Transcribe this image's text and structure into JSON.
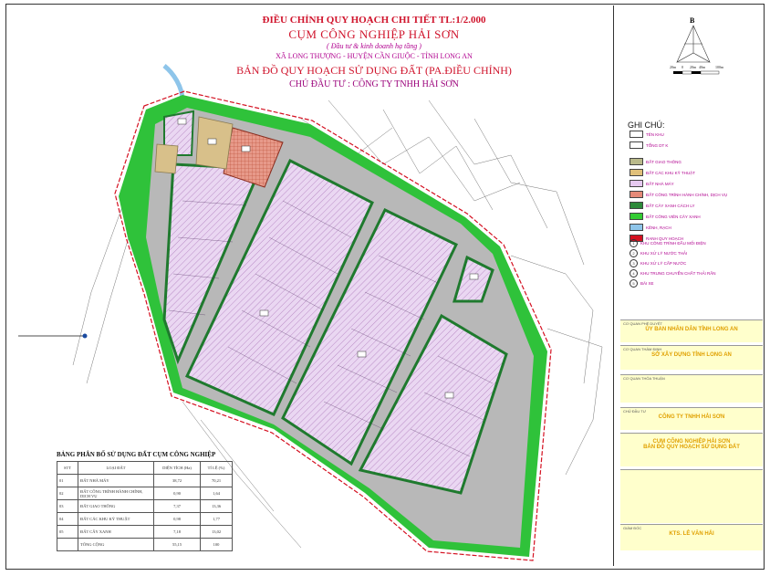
{
  "header": {
    "line1": "ĐIỀU CHỈNH QUY HOẠCH CHI TIẾT TL:1/2.000",
    "line2": "CỤM CÔNG NGHIỆP HẢI SƠN",
    "line3": "( Đầu tư & kinh doanh hạ tầng )",
    "line4": "XÃ LONG THƯỢNG - HUYỆN CẦN GIUỘC - TỈNH LONG AN",
    "line5": "BẢN ĐỒ QUY HOẠCH SỬ DỤNG ĐẤT (PA.ĐIỀU CHỈNH)",
    "line6": "CHỦ ĐẦU TƯ : CÔNG TY TNHH HẢI SƠN"
  },
  "compass": {
    "label": "B",
    "scale": [
      "20m",
      "0",
      "20m",
      "40m",
      "100m"
    ]
  },
  "legend": {
    "title": "GHI CHÚ:",
    "block_label": "TÊN KHU",
    "area_label": "TỔNG DT K",
    "items": [
      {
        "label": "ĐẤT GIAO THÔNG",
        "color": "#b9b98a"
      },
      {
        "label": "ĐẤT CÁC KHU KỸ THUẬT",
        "color": "#e0c07a"
      },
      {
        "label": "ĐẤT NHÀ MÁY",
        "color": "#e6c9f0"
      },
      {
        "label": "ĐẤT CÔNG TRÌNH HÀNH CHÍNH, DỊCH VỤ",
        "color": "#e58a78"
      },
      {
        "label": "ĐẤT CÂY XANH CÁCH LY",
        "color": "#2d8a3a"
      },
      {
        "label": "ĐẤT CÔNG VIÊN CÂY XANH",
        "color": "#33cc33"
      },
      {
        "label": "KÊNH, RẠCH",
        "color": "#8ec5ea"
      },
      {
        "label": "RANH QUY HOẠCH",
        "color": "#d41020"
      }
    ],
    "utilities": [
      {
        "n": "1",
        "label": "KHU CÔNG TRÌNH ĐẦU MỐI ĐIỆN"
      },
      {
        "n": "2",
        "label": "KHU XỬ LÝ NƯỚC THẢI"
      },
      {
        "n": "3",
        "label": "KHU XỬ LÝ CẤP NƯỚC"
      },
      {
        "n": "4",
        "label": "KHU TRUNG CHUYỂN CHẤT THẢI RẮN"
      },
      {
        "n": "5",
        "label": "BÃI XE"
      }
    ]
  },
  "title_block": {
    "approve_label": "CƠ QUAN PHÊ DUYỆT",
    "approve": "ỦY BAN NHÂN DÂN TỈNH LONG AN",
    "appraise_label": "CƠ QUAN THẨM ĐỊNH",
    "appraise": "SỞ XÂY DỰNG TỈNH LONG AN",
    "consult_label": "CƠ QUAN THỎA THUẬN",
    "owner_label": "CHỦ ĐẦU TƯ",
    "owner": "CÔNG TY TNHH HẢI SƠN",
    "project": "CỤM CÔNG NGHIỆP HẢI SƠN",
    "drawing": "BẢN ĐỒ QUY HOẠCH SỬ DỤNG ĐẤT",
    "director_label": "GIÁM ĐỐC",
    "director": "KTS. LÊ VĂN HẢI"
  },
  "table": {
    "title": "BẢNG PHÂN BỔ SỬ DỤNG ĐẤT CỤM CÔNG NGHIỆP",
    "headers": [
      "STT",
      "LOẠI ĐẤT",
      "DIỆN TÍCH (Ha)",
      "TỈ LỆ (%)"
    ],
    "rows": [
      [
        "01",
        "ĐẤT NHÀ MÁY",
        "38,72",
        "70,21"
      ],
      [
        "02",
        "ĐẤT CÔNG TRÌNH HÀNH CHÍNH, DỊCH VỤ",
        "0,90",
        "1,64"
      ],
      [
        "03",
        "ĐẤT GIAO THÔNG",
        "7,37",
        "13,36"
      ],
      [
        "04",
        "ĐẤT CÁC KHU KỸ THUẬT",
        "0,98",
        "1,77"
      ],
      [
        "05",
        "ĐẤT CÂY XANH",
        "7,18",
        "13,02"
      ],
      [
        "",
        "TỔNG CỘNG",
        "55,15",
        "100"
      ]
    ]
  }
}
